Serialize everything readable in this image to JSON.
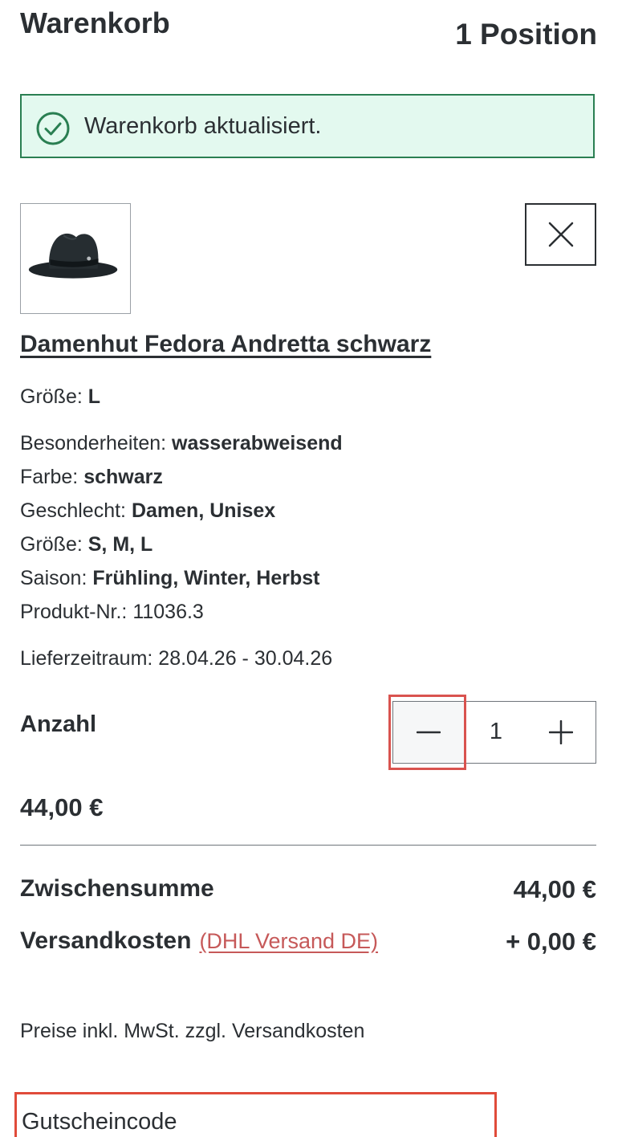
{
  "header": {
    "title": "Warenkorb",
    "position_count": "1 Position"
  },
  "alert": {
    "message": "Warenkorb aktualisiert.",
    "icon": "check-circle-icon",
    "color_bg": "#e3f9ef",
    "color_border": "#2a7f52"
  },
  "product": {
    "name": "Damenhut Fedora Andretta schwarz",
    "image_icon": "hat-image",
    "remove_icon": "close-icon",
    "size_label": "Größe:",
    "size_value": "L",
    "features": [
      {
        "label": "Besonderheiten:",
        "value": "wasserabweisend"
      },
      {
        "label": "Farbe:",
        "value": "schwarz"
      },
      {
        "label": "Geschlecht:",
        "value": "Damen, Unisex"
      },
      {
        "label": "Größe:",
        "value": "S, M, L"
      },
      {
        "label": "Saison:",
        "value": "Frühling, Winter, Herbst"
      }
    ],
    "product_number": "Produkt-Nr.: 11036.3",
    "delivery": "Lieferzeitraum: 28.04.26 - 30.04.26"
  },
  "quantity": {
    "label": "Anzahl",
    "value": "1",
    "minus_icon": "minus-icon",
    "plus_icon": "plus-icon"
  },
  "item_price": "44,00 €",
  "summary": {
    "subtotal_label": "Zwischensumme",
    "subtotal_value": "44,00 €",
    "shipping_label": "Versandkosten",
    "shipping_method": "(DHL Versand DE)",
    "shipping_value": "+ 0,00 €",
    "link_color": "#c65959"
  },
  "tax_note": "Preise inkl. MwSt. zzgl. Versandkosten",
  "coupon": {
    "label": "Gutscheincode"
  }
}
